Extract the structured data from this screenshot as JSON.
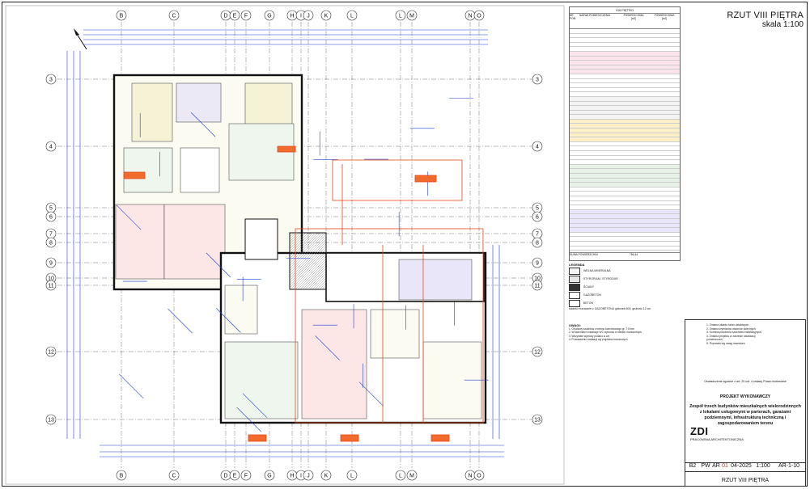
{
  "sheet": {
    "title": "RZUT VIII PIĘTRA",
    "scale": "skala 1:100",
    "footer_title": "RZUT VIII PIĘTRA"
  },
  "grid": {
    "columns": [
      "B",
      "C",
      "D",
      "E",
      "F",
      "G",
      "H",
      "I",
      "J",
      "K",
      "L",
      "M",
      "N",
      "O"
    ],
    "col_labels_top": [
      "B",
      "C",
      "D",
      "E",
      "F",
      "G",
      "H",
      "I",
      "J",
      "K",
      "L",
      "L",
      "M",
      "N",
      "O"
    ],
    "rows": [
      "3",
      "4",
      "5",
      "6",
      "7",
      "8",
      "9",
      "10",
      "11",
      "12",
      "13"
    ]
  },
  "area_table": {
    "header": "VIII PIĘTRO",
    "col1": "NR POM.",
    "col2": "NAZWA POMIESZCZENIA",
    "col3": "POWIERZCHNIA",
    "col4": "POWIERZCHNIA",
    "unit": "[m2]",
    "summary_label": "SUMA POWIERZCHNI",
    "total": "756,44"
  },
  "legend": {
    "title": "LEGENDA",
    "items": [
      {
        "label": "WEŁNA MINERALNA",
        "color": "#f4f4f4",
        "pattern": "hatch"
      },
      {
        "label": "STYROPIAN / STYRODUR",
        "color": "#e8e8e8",
        "pattern": "dots"
      },
      {
        "label": "ŚCIANY",
        "color": "#333333",
        "pattern": "solid"
      },
      {
        "label": "GAZOBETON",
        "color": "#ffffff",
        "pattern": "cross"
      },
      {
        "label": "BETON",
        "color": "#ffffff",
        "pattern": "fill-light"
      }
    ],
    "note": "ścianki murowane z GAZOBETONU gatunek 600, grubość 12 cm"
  },
  "notes": {
    "title": "UWAGI:",
    "lines": [
      "1. Obudowy szachtów z betonu komórkowego gr. 7,5 mm",
      "2. W łazienkach instalacje WC wykonać w stelażu montażowym",
      "3. Wszystkie wymiary podano w cm",
      "4. Prowadzenie instalacji wg projektów branżowych"
    ]
  },
  "title_block": {
    "revisions": [
      "1. Zmiana układu ścian działowych",
      "2. Zmiana wymiarów otworów okiennych",
      "3. Korekta położenia szachtów instalacyjnych",
      "4. Zmiana projektu w zakresie lokalizacji pomieszczeń",
      "5. Poprawki wg uwag inwestora"
    ],
    "stamp_text": "Oświadczenie zgodnie z art. 20 ust. 4 ustawy Prawo budowlane",
    "phase": "PROJEKT WYKONAWCZY",
    "project_name": "Zespół trzech budynków mieszkalnych wielorodzinnych z lokalami usługowymi w parterach, garażami podziemnymi, infrastrukturą techniczną i zagospodarowaniem terenu",
    "office_short": "ZDI",
    "office_name": "PRACOWNIA ARCHITEKTONICZNA",
    "code_building": "B2",
    "code_phase": "PW",
    "code_branch": "AR",
    "code_rev": "01",
    "code_date": "04-2025",
    "code_scale": "1:100",
    "code_sheet": "AR-1-10"
  }
}
